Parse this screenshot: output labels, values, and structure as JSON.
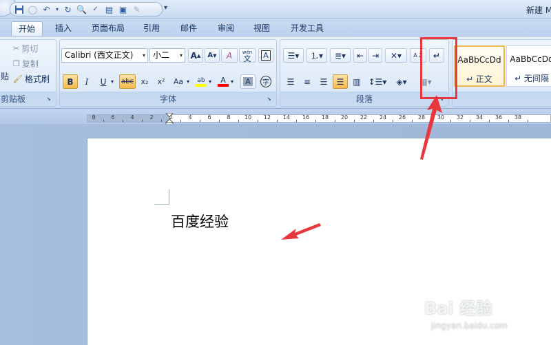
{
  "window": {
    "title": "新建 M"
  },
  "tabs": [
    "开始",
    "插入",
    "页面布局",
    "引用",
    "邮件",
    "审阅",
    "视图",
    "开发工具"
  ],
  "clipboard": {
    "paste_label": "贴",
    "cut": "剪切",
    "copy": "复制",
    "format_painter": "格式刷",
    "group_label": "剪贴板"
  },
  "font": {
    "font_name": "Calibri (西文正文)",
    "font_size": "小二",
    "grow": "A",
    "shrink": "A",
    "clear": "A",
    "phonetic": "wén",
    "phonetic_char": "文",
    "border_char": "A",
    "bold": "B",
    "italic": "I",
    "underline": "U",
    "strike": "abc",
    "subscript": "x₂",
    "superscript": "x²",
    "change_case": "Aa",
    "highlight": "ab",
    "font_color": "A",
    "shading_char": "A",
    "enclose_char": "字",
    "group_label": "字体"
  },
  "paragraph": {
    "sort": "A Z",
    "group_label": "段落"
  },
  "styles": [
    {
      "sample": "AaBbCcDd",
      "name": "↵ 正文"
    },
    {
      "sample": "AaBbCcDd",
      "name": "↵ 无间隔"
    }
  ],
  "ruler": {
    "ticks": [
      "8",
      "6",
      "4",
      "2",
      "2",
      "4",
      "6",
      "8",
      "10",
      "12",
      "14",
      "16",
      "18",
      "20",
      "22",
      "24",
      "26",
      "28",
      "30",
      "32",
      "34",
      "36",
      "38"
    ]
  },
  "document": {
    "text": "百度经验"
  },
  "watermark": {
    "brand": "Bai 经验",
    "url": "jingyan.baidu.com"
  },
  "colors": {
    "highlight_yellow": "#ffff00",
    "font_red": "#ff0000",
    "annotation_red": "#e8383d"
  }
}
